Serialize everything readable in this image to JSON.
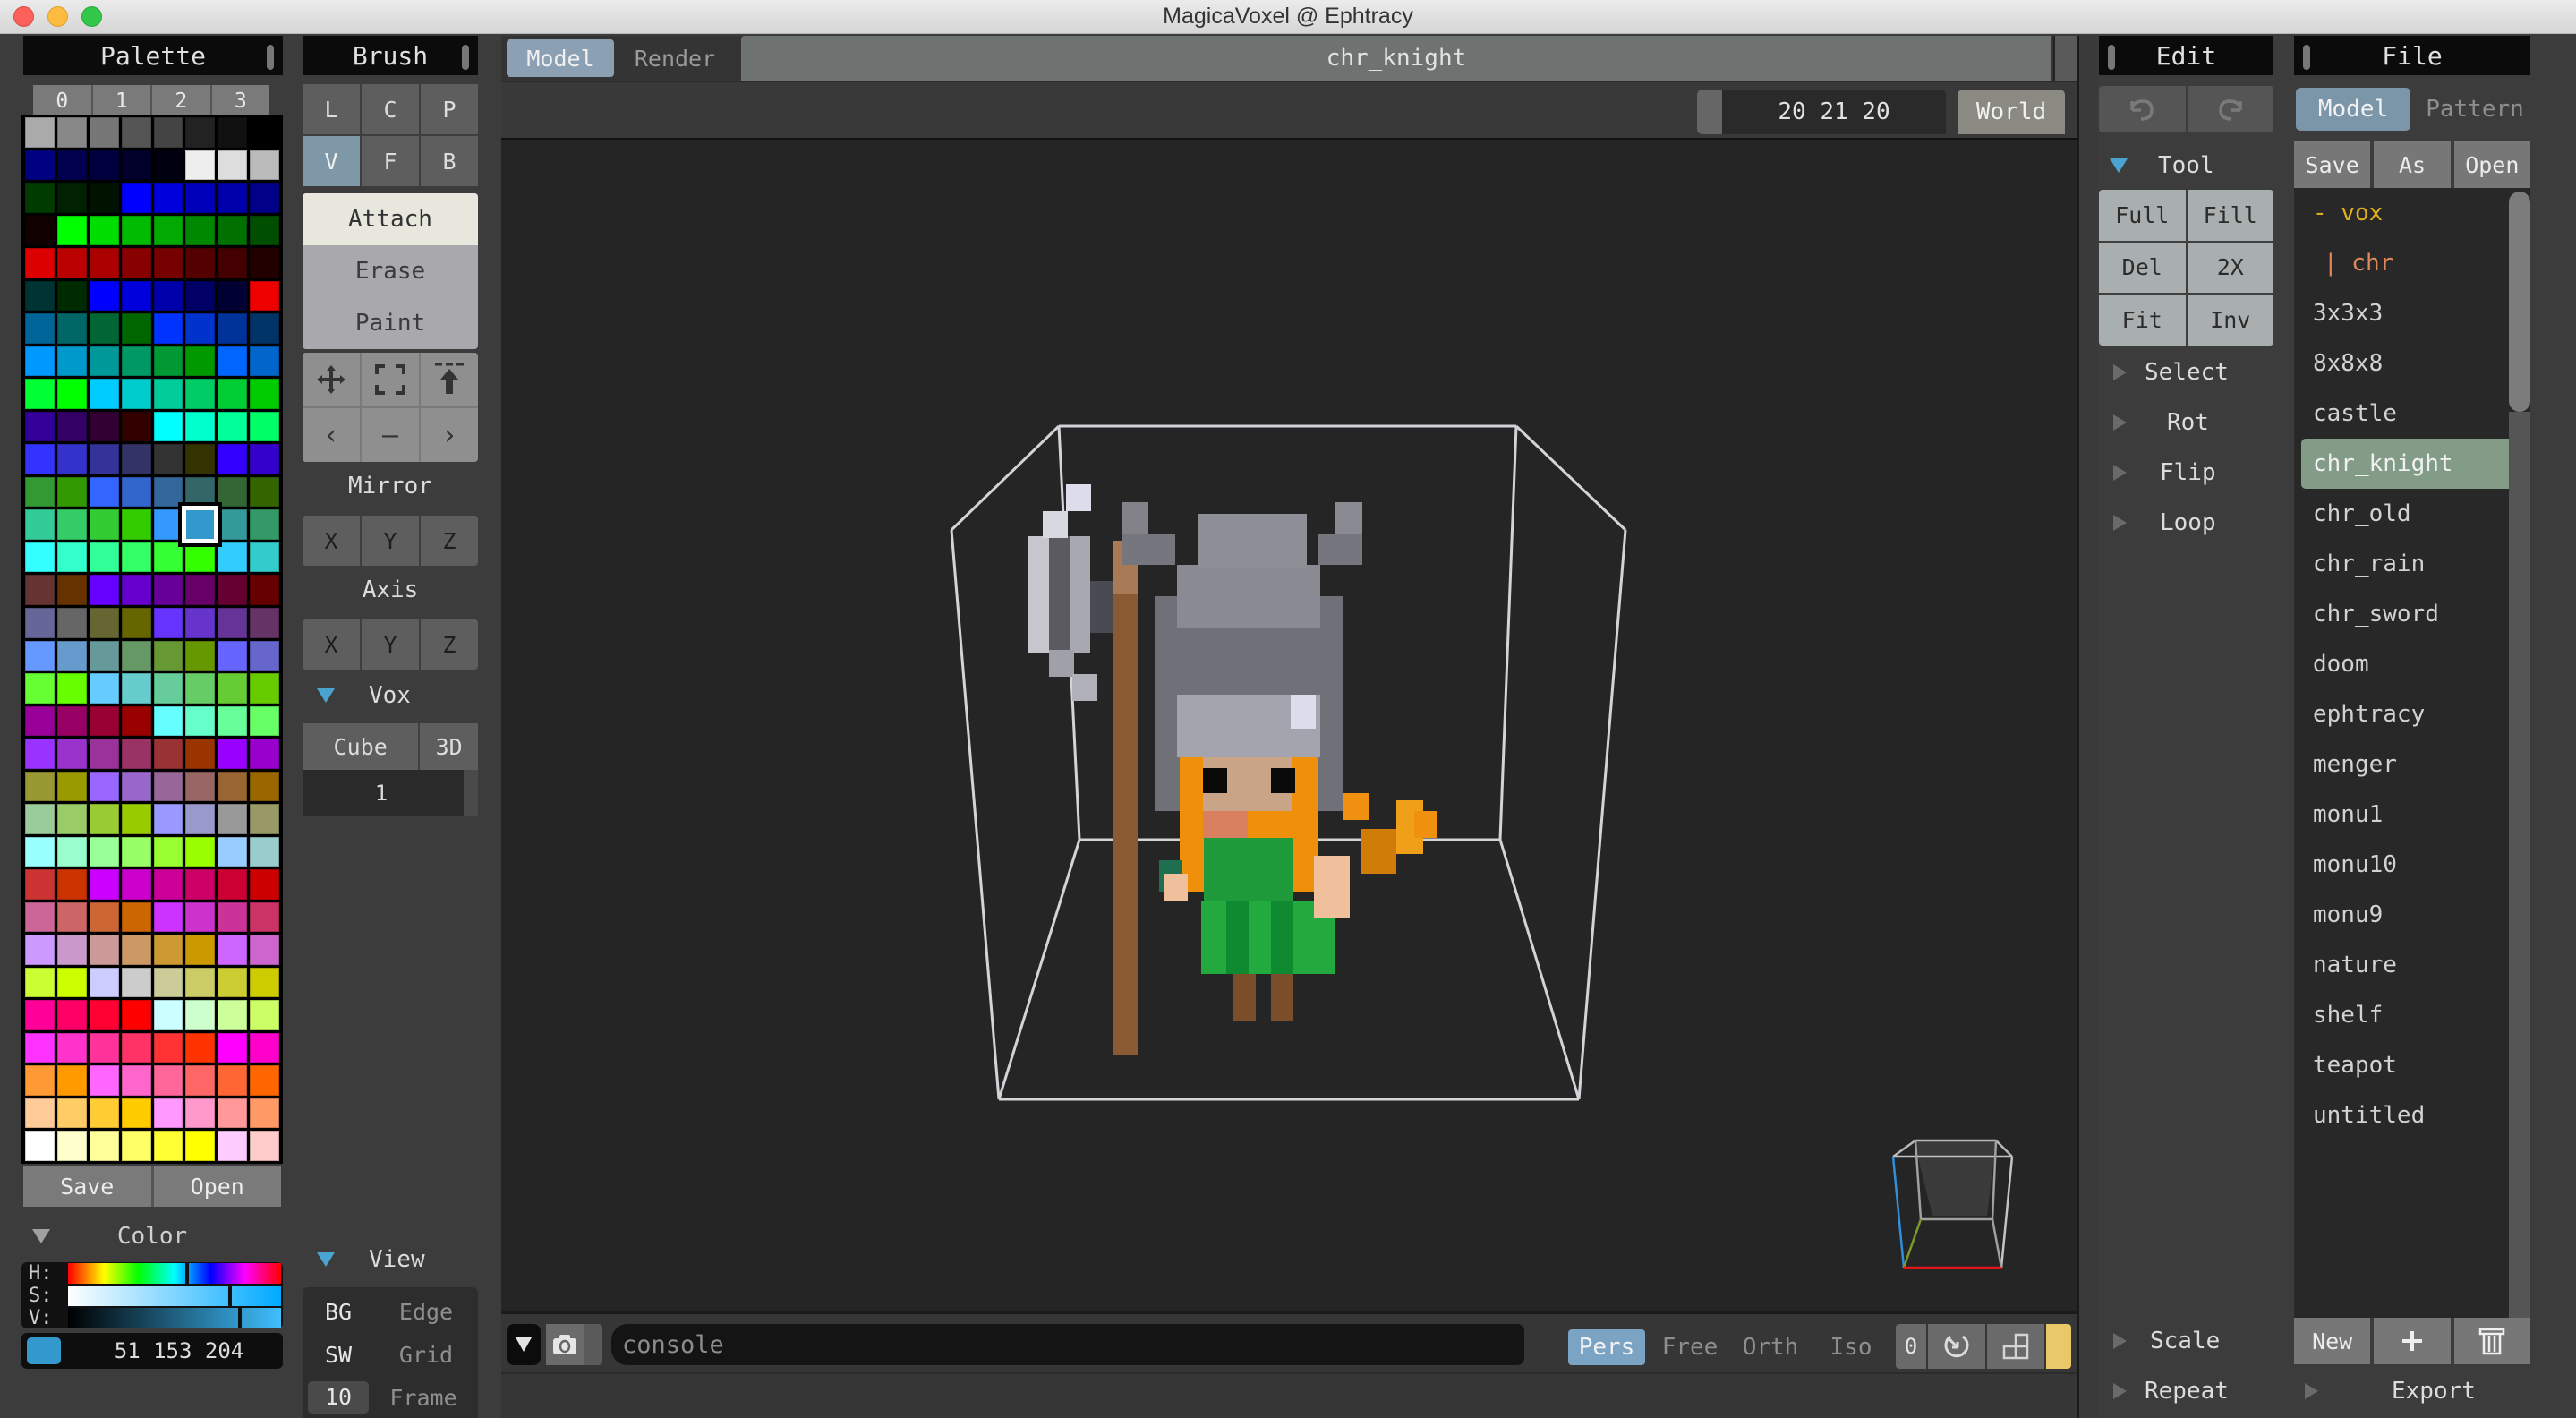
{
  "window": {
    "title": "MagicaVoxel @ Ephtracy"
  },
  "palette": {
    "header": "Palette",
    "tabs": [
      "0",
      "1",
      "2",
      "3"
    ],
    "selected_index": 101,
    "colors": [
      "#aaaaaa",
      "#888888",
      "#777777",
      "#555555",
      "#444444",
      "#222222",
      "#111111",
      "#000000",
      "#000080",
      "#00004f",
      "#00003f",
      "#00002a",
      "#00000f",
      "#eeeeee",
      "#dddddd",
      "#bbbbbb",
      "#003c00",
      "#002200",
      "#001300",
      "#0000ff",
      "#0000dd",
      "#0000bb",
      "#0000aa",
      "#000088",
      "#110000",
      "#00ff00",
      "#00dd00",
      "#00bb00",
      "#00aa00",
      "#008800",
      "#007000",
      "#004f00",
      "#dd0000",
      "#bb0000",
      "#aa0000",
      "#880000",
      "#770000",
      "#550000",
      "#440000",
      "#220000",
      "#003333",
      "#002a00",
      "#0000ff",
      "#0000dd",
      "#0000aa",
      "#000066",
      "#000033",
      "#ee0000",
      "#006699",
      "#006666",
      "#006633",
      "#006600",
      "#0033ff",
      "#0033cc",
      "#003399",
      "#003366",
      "#0099ff",
      "#0099cc",
      "#009999",
      "#009966",
      "#009933",
      "#009900",
      "#0066ff",
      "#0066cc",
      "#00ff33",
      "#00ff00",
      "#00ccff",
      "#00cccc",
      "#00cc99",
      "#00cc66",
      "#00cc33",
      "#00cc00",
      "#330099",
      "#330066",
      "#330033",
      "#330000",
      "#00ffff",
      "#00ffcc",
      "#00ff99",
      "#00ff66",
      "#3333ff",
      "#3333cc",
      "#333399",
      "#333366",
      "#333333",
      "#333300",
      "#3300ff",
      "#3300cc",
      "#339933",
      "#339900",
      "#3366ff",
      "#3366cc",
      "#336699",
      "#336666",
      "#336633",
      "#336600",
      "#33cc99",
      "#33cc66",
      "#33cc33",
      "#33cc00",
      "#3399ff",
      "#3399cc",
      "#339999",
      "#339966",
      "#33ffff",
      "#33ffcc",
      "#33ff99",
      "#33ff66",
      "#33ff33",
      "#33ff00",
      "#33ccff",
      "#33cccc",
      "#663333",
      "#663300",
      "#6600ff",
      "#6600cc",
      "#660099",
      "#660066",
      "#660033",
      "#660000",
      "#666699",
      "#666666",
      "#666633",
      "#666600",
      "#6633ff",
      "#6633cc",
      "#663399",
      "#663366",
      "#6699ff",
      "#6699cc",
      "#669999",
      "#669966",
      "#669933",
      "#669900",
      "#6666ff",
      "#6666cc",
      "#66ff33",
      "#66ff00",
      "#66ccff",
      "#66cccc",
      "#66cc99",
      "#66cc66",
      "#66cc33",
      "#66cc00",
      "#990099",
      "#990066",
      "#990033",
      "#990000",
      "#66ffff",
      "#66ffcc",
      "#66ff99",
      "#66ff66",
      "#9933ff",
      "#9933cc",
      "#993399",
      "#993366",
      "#993333",
      "#993300",
      "#9900ff",
      "#9900cc",
      "#999933",
      "#999900",
      "#9966ff",
      "#9966cc",
      "#996699",
      "#996666",
      "#996633",
      "#996600",
      "#99cc99",
      "#99cc66",
      "#99cc33",
      "#99cc00",
      "#9999ff",
      "#9999cc",
      "#999999",
      "#999966",
      "#99ffff",
      "#99ffcc",
      "#99ff99",
      "#99ff66",
      "#99ff33",
      "#99ff00",
      "#99ccff",
      "#99cccc",
      "#cc3333",
      "#cc3300",
      "#cc00ff",
      "#cc00cc",
      "#cc0099",
      "#cc0066",
      "#cc0033",
      "#cc0000",
      "#cc6699",
      "#cc6666",
      "#cc6633",
      "#cc6600",
      "#cc33ff",
      "#cc33cc",
      "#cc3399",
      "#cc3366",
      "#cc99ff",
      "#cc99cc",
      "#cc9999",
      "#cc9966",
      "#cc9933",
      "#cc9900",
      "#cc66ff",
      "#cc66cc",
      "#ccff33",
      "#ccff00",
      "#ccccff",
      "#cccccc",
      "#cccc99",
      "#cccc66",
      "#cccc33",
      "#cccc00",
      "#ff0099",
      "#ff0066",
      "#ff0033",
      "#ff0000",
      "#ccffff",
      "#ccffcc",
      "#ccff99",
      "#ccff66",
      "#ff33ff",
      "#ff33cc",
      "#ff3399",
      "#ff3366",
      "#ff3333",
      "#ff3300",
      "#ff00ff",
      "#ff00cc",
      "#ff9933",
      "#ff9900",
      "#ff66ff",
      "#ff66cc",
      "#ff6699",
      "#ff6666",
      "#ff6633",
      "#ff6600",
      "#ffcc99",
      "#ffcc66",
      "#ffcc33",
      "#ffcc00",
      "#ff99ff",
      "#ff99cc",
      "#ff9999",
      "#ff9966",
      "#ffffff",
      "#ffffcc",
      "#ffff99",
      "#ffff66",
      "#ffff33",
      "#ffff00",
      "#ffccff",
      "#ffcccc"
    ],
    "save_label": "Save",
    "open_label": "Open"
  },
  "color": {
    "header": "Color",
    "h_label": "H:",
    "s_label": "S:",
    "v_label": "V:",
    "h_value": 0.55,
    "s_value": 0.75,
    "v_value": 0.8,
    "rgb_text": "51 153 204",
    "swatch": "#3399cc"
  },
  "brush": {
    "header": "Brush",
    "modes_row1": [
      "L",
      "C",
      "P"
    ],
    "modes_row2": [
      "V",
      "F",
      "B"
    ],
    "active_mode": "V",
    "actions": [
      "Attach",
      "Erase",
      "Paint"
    ],
    "active_action": "Attach",
    "mirror_label": "Mirror",
    "mirror_axes": [
      "X",
      "Y",
      "Z"
    ],
    "axis_label": "Axis",
    "axis_axes": [
      "X",
      "Y",
      "Z"
    ],
    "vox_label": "Vox",
    "vox_shape": "Cube",
    "vox_dim": "3D",
    "vox_size": "1",
    "view_label": "View",
    "view_rows": [
      {
        "key": "BG",
        "value": "Edge"
      },
      {
        "key": "SW",
        "value": "Grid"
      },
      {
        "key": "10",
        "value": "Frame"
      }
    ]
  },
  "viewport": {
    "tabs": [
      "Model",
      "Render"
    ],
    "active_tab": "Model",
    "model_name": "chr_knight",
    "dimensions": "20 21 20",
    "space_label": "World",
    "console_placeholder": "console",
    "camera_modes": [
      "Pers",
      "Free",
      "Orth",
      "Iso"
    ],
    "active_camera": "Pers",
    "camera_index": "0"
  },
  "edit": {
    "header": "Edit",
    "tool_label": "Tool",
    "tool_buttons": [
      [
        "Full",
        "Fill"
      ],
      [
        "Del",
        "2X"
      ],
      [
        "Fit",
        "Inv"
      ]
    ],
    "sections": [
      "Select",
      "Rot",
      "Flip",
      "Loop"
    ],
    "bottom_sections": [
      "Scale",
      "Repeat"
    ]
  },
  "file": {
    "header": "File",
    "tabs": [
      "Model",
      "Pattern"
    ],
    "active_tab": "Model",
    "actions": [
      "Save",
      "As",
      "Open"
    ],
    "folder": "- vox",
    "subfolder": "| chr",
    "items": [
      "3x3x3",
      "8x8x8",
      "castle",
      "chr_knight",
      "chr_old",
      "chr_rain",
      "chr_sword",
      "doom",
      "ephtracy",
      "menger",
      "monu1",
      "monu10",
      "monu9",
      "nature",
      "shelf",
      "teapot",
      "untitled"
    ],
    "selected_item": "chr_knight",
    "new_label": "New",
    "export_label": "Export"
  }
}
